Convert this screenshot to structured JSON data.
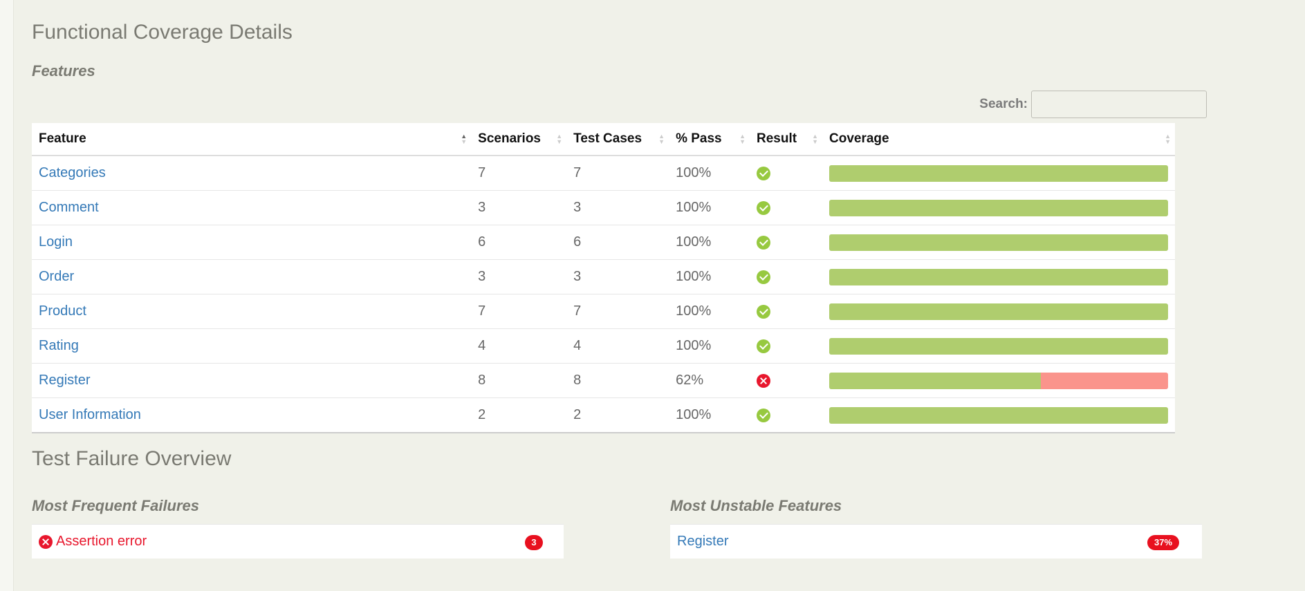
{
  "coverage": {
    "title": "Functional Coverage Details",
    "subtitle": "Features",
    "search": {
      "label": "Search:",
      "value": ""
    },
    "columns": [
      "Feature",
      "Scenarios",
      "Test Cases",
      "% Pass",
      "Result",
      "Coverage"
    ],
    "rows": [
      {
        "feature": "Categories",
        "scenarios": "7",
        "test_cases": "7",
        "pass_pct": "100%",
        "result": "pass",
        "coverage_pass": 1.0
      },
      {
        "feature": "Comment",
        "scenarios": "3",
        "test_cases": "3",
        "pass_pct": "100%",
        "result": "pass",
        "coverage_pass": 1.0
      },
      {
        "feature": "Login",
        "scenarios": "6",
        "test_cases": "6",
        "pass_pct": "100%",
        "result": "pass",
        "coverage_pass": 1.0
      },
      {
        "feature": "Order",
        "scenarios": "3",
        "test_cases": "3",
        "pass_pct": "100%",
        "result": "pass",
        "coverage_pass": 1.0
      },
      {
        "feature": "Product",
        "scenarios": "7",
        "test_cases": "7",
        "pass_pct": "100%",
        "result": "pass",
        "coverage_pass": 1.0
      },
      {
        "feature": "Rating",
        "scenarios": "4",
        "test_cases": "4",
        "pass_pct": "100%",
        "result": "pass",
        "coverage_pass": 1.0
      },
      {
        "feature": "Register",
        "scenarios": "8",
        "test_cases": "8",
        "pass_pct": "62%",
        "result": "fail",
        "coverage_pass": 0.625
      },
      {
        "feature": "User Information",
        "scenarios": "2",
        "test_cases": "2",
        "pass_pct": "100%",
        "result": "pass",
        "coverage_pass": 1.0
      }
    ]
  },
  "failure_overview": {
    "title": "Test Failure Overview",
    "frequent": {
      "title": "Most Frequent Failures",
      "item_label": "Assertion error",
      "item_icon": "error-circle-icon",
      "count": "3"
    },
    "unstable": {
      "title": "Most Unstable Features",
      "item_label": "Register",
      "pct": "37%"
    }
  },
  "colors": {
    "background": "#f0f1e9",
    "link": "#3479b7",
    "pass_icon": "#97c940",
    "fail_icon": "#e8172d",
    "bar_pass": "#afcd6e",
    "bar_fail": "#fa948c",
    "badge": "#e8101f"
  }
}
